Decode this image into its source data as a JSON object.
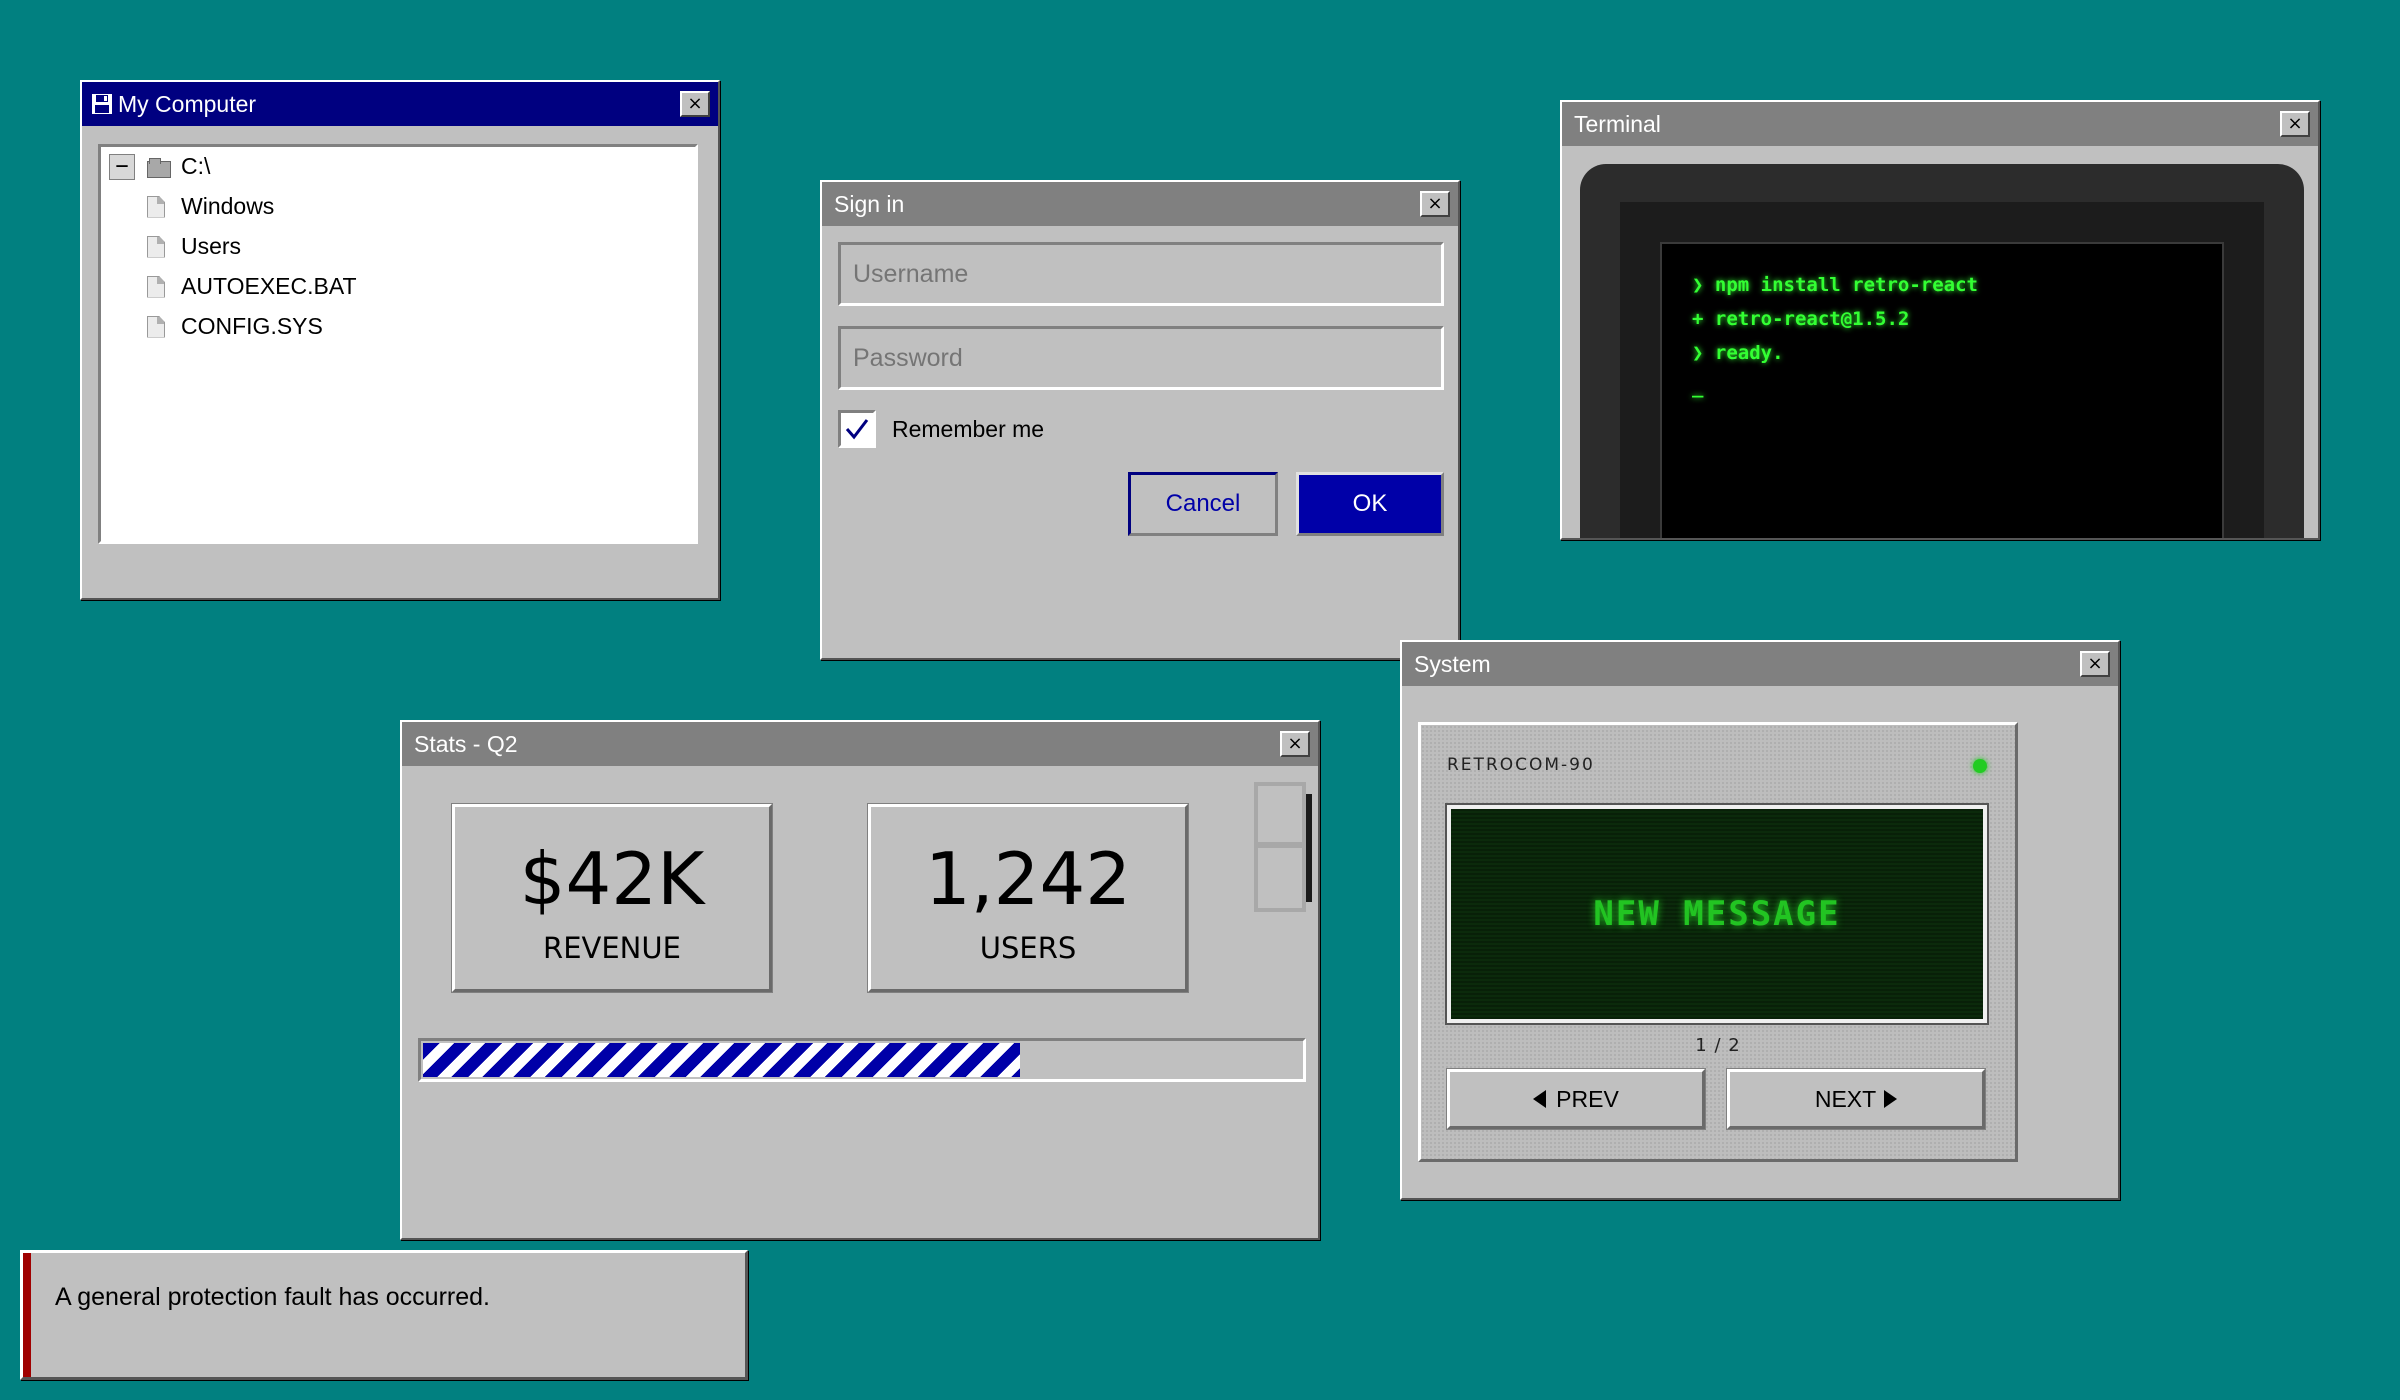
{
  "my_computer": {
    "title": "My Computer",
    "close_label": "×",
    "tree": [
      {
        "label": "C:\\",
        "expander": "−",
        "type": "folder"
      },
      {
        "label": "Windows",
        "type": "file"
      },
      {
        "label": "Users",
        "type": "file"
      },
      {
        "label": "AUTOEXEC.BAT",
        "type": "file"
      },
      {
        "label": "CONFIG.SYS",
        "type": "file"
      }
    ]
  },
  "signin": {
    "title": "Sign in",
    "close_label": "×",
    "username_placeholder": "Username",
    "password_placeholder": "Password",
    "remember_label": "Remember me",
    "remember_checked": true,
    "cancel_label": "Cancel",
    "ok_label": "OK"
  },
  "terminal": {
    "title": "Terminal",
    "close_label": "×",
    "lines": [
      "❯ npm install retro-react",
      "+ retro-react@1.5.2",
      "❯ ready.",
      "_"
    ],
    "text_color": "#33ff33"
  },
  "stats": {
    "title": "Stats - Q2",
    "close_label": "×",
    "cards": [
      {
        "value": "$42K",
        "label": "REVENUE"
      },
      {
        "value": "1,242",
        "label": "USERS"
      }
    ],
    "progress_fraction": 0.68,
    "progress_color": "#0000a8"
  },
  "system": {
    "title": "System",
    "close_label": "×",
    "device_name": "RETROCOM-90",
    "led_color": "#22cc22",
    "screen_message": "NEW MESSAGE",
    "page_indicator": "1 / 2",
    "prev_label": "PREV",
    "next_label": "NEXT"
  },
  "error": {
    "message": "A general protection fault has occurred.",
    "accent_color": "#a00000"
  },
  "colors": {
    "desktop": "#018080",
    "active_title": "#000080",
    "inactive_title": "#808080"
  }
}
